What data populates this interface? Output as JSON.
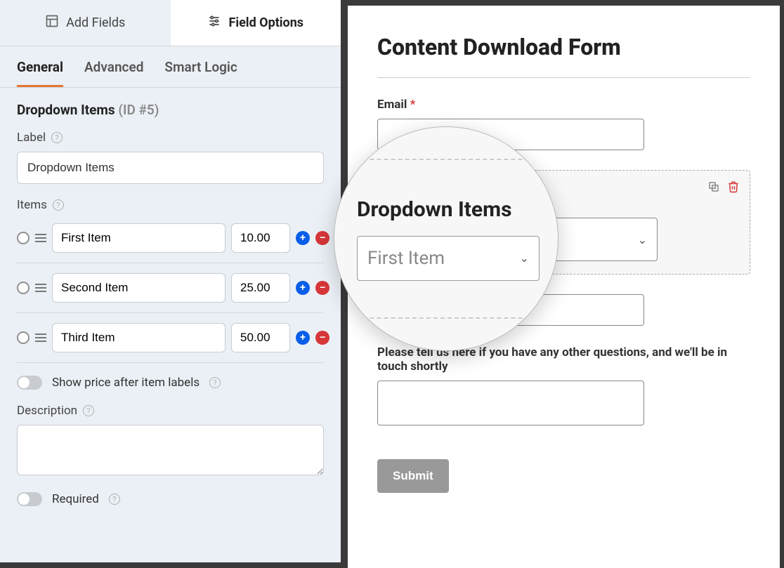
{
  "top_tabs": {
    "add_fields": "Add Fields",
    "field_options": "Field Options"
  },
  "sub_tabs": {
    "general": "General",
    "advanced": "Advanced",
    "smart_logic": "Smart Logic"
  },
  "field_heading": {
    "title": "Dropdown Items",
    "id_tag": "(ID #5)"
  },
  "options": {
    "label_label": "Label",
    "label_value": "Dropdown Items",
    "items_label": "Items",
    "items": [
      {
        "label": "First Item",
        "price": "10.00"
      },
      {
        "label": "Second Item",
        "price": "25.00"
      },
      {
        "label": "Third Item",
        "price": "50.00"
      }
    ],
    "show_price_label": "Show price after item labels",
    "description_label": "Description",
    "description_value": "",
    "required_label": "Required"
  },
  "preview": {
    "form_title": "Content Download Form",
    "email_label": "Email",
    "required_mark": "*",
    "dropdown_label": "Dropdown Items",
    "dropdown_selected": "First Item",
    "questions_label": "Please tell us here if you have any other questions, and we'll be in touch shortly",
    "submit_label": "Submit"
  }
}
